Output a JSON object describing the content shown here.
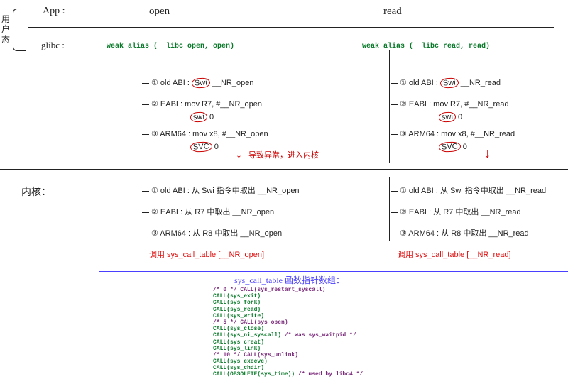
{
  "left": {
    "user_state": "用\n户\n态",
    "app": "App :",
    "glibc": "glibc :",
    "kernel": "内核："
  },
  "cols": {
    "open": {
      "head": "open",
      "alias": "weak_alias (__libc_open, open)",
      "abi1_label": "① old ABI :",
      "abi1_instr_a": "Swi",
      "abi1_instr_b": "__NR_open",
      "abi2_label": "② EABI :",
      "abi2_line1": "mov R7, #__NR_open",
      "abi2_line2a": "swi",
      "abi2_line2b": "0",
      "abi3_label": "③ ARM64 :",
      "abi3_line1": "mov x8, #__NR_open",
      "abi3_line2a": "SVC",
      "abi3_line2b": "0",
      "kern1": "① old ABI :  从 Swi 指令中取出 __NR_open",
      "kern2": "② EABI :    从 R7 中取出 __NR_open",
      "kern3": "③ ARM64 :   从 R8 中取出 __NR_open",
      "call": "调用 sys_call_table [__NR_open]"
    },
    "read": {
      "head": "read",
      "alias": "weak_alias (__libc_read, read)",
      "abi1_label": "① old ABI :",
      "abi1_instr_a": "Swi",
      "abi1_instr_b": "__NR_read",
      "abi2_label": "② EABI :",
      "abi2_line1": "mov R7, #__NR_read",
      "abi2_line2a": "swi",
      "abi2_line2b": "0",
      "abi3_label": "③ ARM64 :",
      "abi3_line1": "mov x8, #__NR_read",
      "abi3_line2a": "SVC",
      "abi3_line2b": "0",
      "kern1": "① old ABI :  从 Swi 指令中取出 __NR_read",
      "kern2": "② EABI :    从 R7 中取出 __NR_read",
      "kern3": "③ ARM64 :   从 R8 中取出 __NR_read",
      "call": "调用 sys_call_table [__NR_read]"
    }
  },
  "red_mid_note": "导致异常，进入内核",
  "table_title": "sys_call_table 函数指针数组：",
  "code": {
    "l0": "/* 0 */    CALL(sys_restart_syscall)",
    "l1": "           CALL(sys_exit)",
    "l2": "           CALL(sys_fork)",
    "l3": "           CALL(sys_read)",
    "l4": "           CALL(sys_write)",
    "l5": "/* 5 */       CALL(sys_open)",
    "l6": "           CALL(sys_close)",
    "l7a": "           CALL(sys_ni_syscall)",
    "l7b": "      /* was sys_waitpid */",
    "l8": "           CALL(sys_creat)",
    "l9": "           CALL(sys_link)",
    "l10": "/* 10 */      CALL(sys_unlink)",
    "l11": "           CALL(sys_execve)",
    "l12": "           CALL(sys_chdir)",
    "l13a": "           CALL(OBSOLETE(sys_time))",
    "l13b": "   /* used by libc4 */"
  }
}
